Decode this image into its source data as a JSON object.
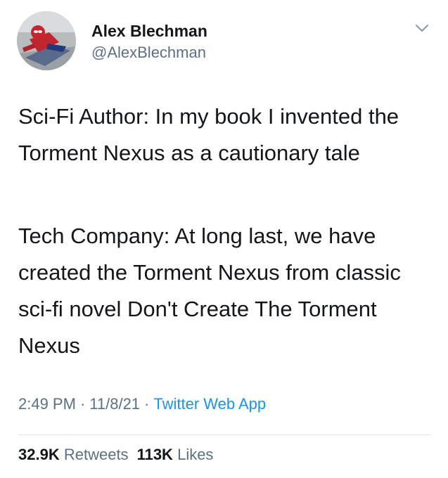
{
  "author": {
    "name": "Alex Blechman",
    "handle": "@AlexBlechman"
  },
  "icons": {
    "avatar": "spiderman-avatar",
    "menu": "chevron-down-icon"
  },
  "tweet": {
    "paragraph1": "Sci-Fi Author: In my book I invented the Torment Nexus as a cautionary tale",
    "paragraph2": "Tech Company: At long last, we have created the Torment Nexus from classic sci-fi novel Don't Create The Torment Nexus"
  },
  "meta": {
    "time": "2:49 PM",
    "separator": "·",
    "date": "11/8/21",
    "source": "Twitter Web App"
  },
  "stats": {
    "retweets_count": "32.9K",
    "retweets_label": "Retweets",
    "likes_count": "113K",
    "likes_label": "Likes"
  },
  "colors": {
    "text": "#14171a",
    "secondary": "#5b7083",
    "link": "#1b95e0",
    "divider": "#e1e8ed"
  }
}
